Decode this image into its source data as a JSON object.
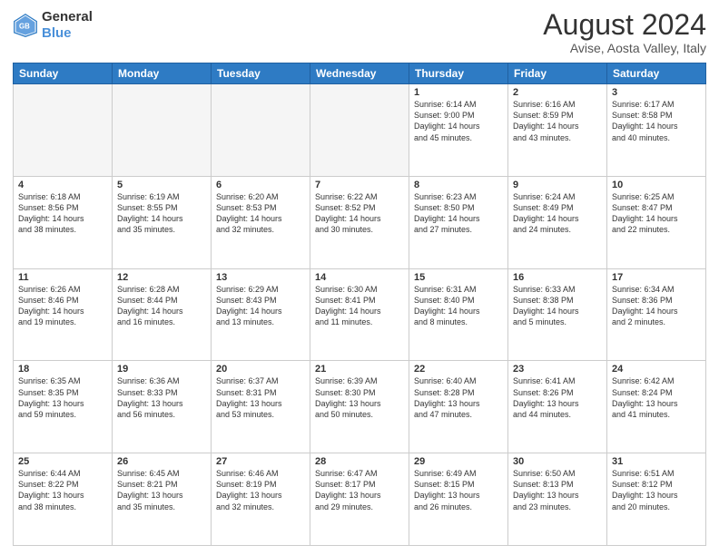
{
  "header": {
    "logo_line1": "General",
    "logo_line2": "Blue",
    "month_year": "August 2024",
    "location": "Avise, Aosta Valley, Italy"
  },
  "weekdays": [
    "Sunday",
    "Monday",
    "Tuesday",
    "Wednesday",
    "Thursday",
    "Friday",
    "Saturday"
  ],
  "weeks": [
    [
      {
        "day": "",
        "info": ""
      },
      {
        "day": "",
        "info": ""
      },
      {
        "day": "",
        "info": ""
      },
      {
        "day": "",
        "info": ""
      },
      {
        "day": "1",
        "info": "Sunrise: 6:14 AM\nSunset: 9:00 PM\nDaylight: 14 hours\nand 45 minutes."
      },
      {
        "day": "2",
        "info": "Sunrise: 6:16 AM\nSunset: 8:59 PM\nDaylight: 14 hours\nand 43 minutes."
      },
      {
        "day": "3",
        "info": "Sunrise: 6:17 AM\nSunset: 8:58 PM\nDaylight: 14 hours\nand 40 minutes."
      }
    ],
    [
      {
        "day": "4",
        "info": "Sunrise: 6:18 AM\nSunset: 8:56 PM\nDaylight: 14 hours\nand 38 minutes."
      },
      {
        "day": "5",
        "info": "Sunrise: 6:19 AM\nSunset: 8:55 PM\nDaylight: 14 hours\nand 35 minutes."
      },
      {
        "day": "6",
        "info": "Sunrise: 6:20 AM\nSunset: 8:53 PM\nDaylight: 14 hours\nand 32 minutes."
      },
      {
        "day": "7",
        "info": "Sunrise: 6:22 AM\nSunset: 8:52 PM\nDaylight: 14 hours\nand 30 minutes."
      },
      {
        "day": "8",
        "info": "Sunrise: 6:23 AM\nSunset: 8:50 PM\nDaylight: 14 hours\nand 27 minutes."
      },
      {
        "day": "9",
        "info": "Sunrise: 6:24 AM\nSunset: 8:49 PM\nDaylight: 14 hours\nand 24 minutes."
      },
      {
        "day": "10",
        "info": "Sunrise: 6:25 AM\nSunset: 8:47 PM\nDaylight: 14 hours\nand 22 minutes."
      }
    ],
    [
      {
        "day": "11",
        "info": "Sunrise: 6:26 AM\nSunset: 8:46 PM\nDaylight: 14 hours\nand 19 minutes."
      },
      {
        "day": "12",
        "info": "Sunrise: 6:28 AM\nSunset: 8:44 PM\nDaylight: 14 hours\nand 16 minutes."
      },
      {
        "day": "13",
        "info": "Sunrise: 6:29 AM\nSunset: 8:43 PM\nDaylight: 14 hours\nand 13 minutes."
      },
      {
        "day": "14",
        "info": "Sunrise: 6:30 AM\nSunset: 8:41 PM\nDaylight: 14 hours\nand 11 minutes."
      },
      {
        "day": "15",
        "info": "Sunrise: 6:31 AM\nSunset: 8:40 PM\nDaylight: 14 hours\nand 8 minutes."
      },
      {
        "day": "16",
        "info": "Sunrise: 6:33 AM\nSunset: 8:38 PM\nDaylight: 14 hours\nand 5 minutes."
      },
      {
        "day": "17",
        "info": "Sunrise: 6:34 AM\nSunset: 8:36 PM\nDaylight: 14 hours\nand 2 minutes."
      }
    ],
    [
      {
        "day": "18",
        "info": "Sunrise: 6:35 AM\nSunset: 8:35 PM\nDaylight: 13 hours\nand 59 minutes."
      },
      {
        "day": "19",
        "info": "Sunrise: 6:36 AM\nSunset: 8:33 PM\nDaylight: 13 hours\nand 56 minutes."
      },
      {
        "day": "20",
        "info": "Sunrise: 6:37 AM\nSunset: 8:31 PM\nDaylight: 13 hours\nand 53 minutes."
      },
      {
        "day": "21",
        "info": "Sunrise: 6:39 AM\nSunset: 8:30 PM\nDaylight: 13 hours\nand 50 minutes."
      },
      {
        "day": "22",
        "info": "Sunrise: 6:40 AM\nSunset: 8:28 PM\nDaylight: 13 hours\nand 47 minutes."
      },
      {
        "day": "23",
        "info": "Sunrise: 6:41 AM\nSunset: 8:26 PM\nDaylight: 13 hours\nand 44 minutes."
      },
      {
        "day": "24",
        "info": "Sunrise: 6:42 AM\nSunset: 8:24 PM\nDaylight: 13 hours\nand 41 minutes."
      }
    ],
    [
      {
        "day": "25",
        "info": "Sunrise: 6:44 AM\nSunset: 8:22 PM\nDaylight: 13 hours\nand 38 minutes."
      },
      {
        "day": "26",
        "info": "Sunrise: 6:45 AM\nSunset: 8:21 PM\nDaylight: 13 hours\nand 35 minutes."
      },
      {
        "day": "27",
        "info": "Sunrise: 6:46 AM\nSunset: 8:19 PM\nDaylight: 13 hours\nand 32 minutes."
      },
      {
        "day": "28",
        "info": "Sunrise: 6:47 AM\nSunset: 8:17 PM\nDaylight: 13 hours\nand 29 minutes."
      },
      {
        "day": "29",
        "info": "Sunrise: 6:49 AM\nSunset: 8:15 PM\nDaylight: 13 hours\nand 26 minutes."
      },
      {
        "day": "30",
        "info": "Sunrise: 6:50 AM\nSunset: 8:13 PM\nDaylight: 13 hours\nand 23 minutes."
      },
      {
        "day": "31",
        "info": "Sunrise: 6:51 AM\nSunset: 8:12 PM\nDaylight: 13 hours\nand 20 minutes."
      }
    ]
  ]
}
